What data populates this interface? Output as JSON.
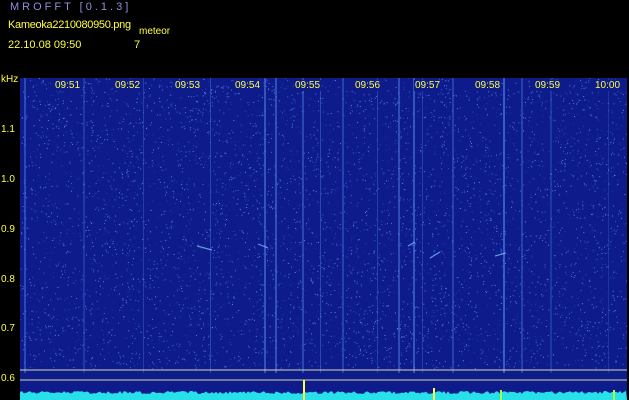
{
  "header": {
    "app_title": "MROFFT [0.1.3]",
    "file_name": "Kameoka2210080950.png",
    "datetime": "22.10.08 09:50",
    "meteor_label": "meteor",
    "meteor_count": "7"
  },
  "axis": {
    "unit": "kHz",
    "y_ticks": [
      "1.1",
      "1.0",
      "0.9",
      "0.8",
      "0.7",
      "0.6"
    ],
    "x_ticks": [
      "09:51",
      "09:52",
      "09:53",
      "09:54",
      "09:55",
      "09:56",
      "09:57",
      "09:58",
      "09:59",
      "10:00"
    ]
  },
  "colors": {
    "background": "#000000",
    "spectrogram_base": "#0d1c8a",
    "text_yellow": "#ffff40",
    "title_blue": "#8f8fe0",
    "signal_cyan": "#27e0ea"
  }
}
